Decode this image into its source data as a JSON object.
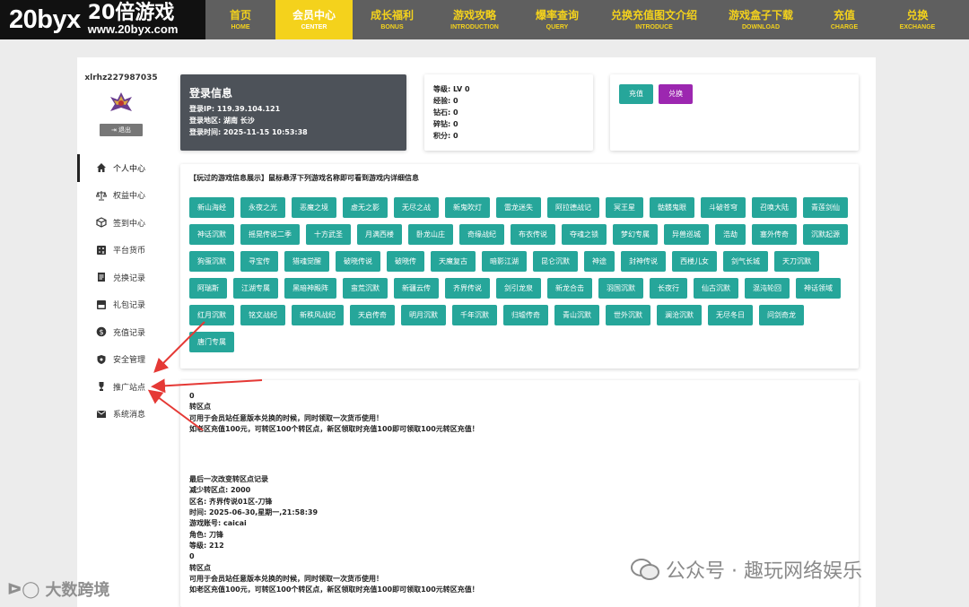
{
  "header": {
    "logo_big": "20byx",
    "logo_cn": "20倍游戏",
    "logo_url": "www.20byx.com",
    "nav": [
      {
        "cn": "首页",
        "en": "HOME",
        "w": 78
      },
      {
        "cn": "会员中心",
        "en": "CENTER",
        "w": 86,
        "active": true
      },
      {
        "cn": "成长福利",
        "en": "BONUS",
        "w": 88
      },
      {
        "cn": "游戏攻略",
        "en": "INTRODUCTION",
        "w": 96
      },
      {
        "cn": "爆率查询",
        "en": "QUERY",
        "w": 88
      },
      {
        "cn": "兑换充值图文介绍",
        "en": "INTRODUCE",
        "w": 128
      },
      {
        "cn": "游戏盒子下载",
        "en": "DOWNLOAD",
        "w": 110
      },
      {
        "cn": "充值",
        "en": "CHARGE",
        "w": 76
      },
      {
        "cn": "兑换",
        "en": "EXCHANGE",
        "w": 87
      }
    ]
  },
  "sidebar": {
    "username": "xlrhz227987035",
    "logout_label": "退出",
    "items": [
      {
        "label": "个人中心",
        "icon": "home-icon",
        "active": true
      },
      {
        "label": "权益中心",
        "icon": "scale-icon"
      },
      {
        "label": "签到中心",
        "icon": "cube-icon"
      },
      {
        "label": "平台货币",
        "icon": "calculator-icon"
      },
      {
        "label": "兑换记录",
        "icon": "document-icon"
      },
      {
        "label": "礼包记录",
        "icon": "gift-box-icon"
      },
      {
        "label": "充值记录",
        "icon": "dollar-icon"
      },
      {
        "label": "安全管理",
        "icon": "shield-icon"
      },
      {
        "label": "推广站点",
        "icon": "trophy-icon"
      },
      {
        "label": "系统消息",
        "icon": "mail-icon"
      }
    ]
  },
  "login": {
    "title": "登录信息",
    "ip": "登录IP:  119.39.104.121",
    "region": "登录地区:  湖南 长沙",
    "time": "登录时间:  2025-11-15 10:53:38"
  },
  "stats": {
    "level": "等级:  LV 0",
    "exp": "经验:  0",
    "diamond": "钻石:  0",
    "broken": "碎钻:  0",
    "points": "积分:  0"
  },
  "actions": {
    "recharge": "充值",
    "exchange": "兑换"
  },
  "games": {
    "hint": "【玩过的游戏信息展示】鼠标悬浮下列游戏名称即可看到游戏内详细信息",
    "items": [
      "新山海经",
      "永夜之光",
      "恶魔之境",
      "虚无之影",
      "无尽之战",
      "新鬼吹灯",
      "雷龙迷失",
      "阿拉德战记",
      "冥王星",
      "骷髅鬼眼",
      "斗破苍穹",
      "召唤大陆",
      "青莲剑仙",
      "神话沉默",
      "摇晃传说二季",
      "十方武圣",
      "月满西楼",
      "卧龙山庄",
      "奇缘战纪",
      "布衣传说",
      "夺魂之锁",
      "梦幻专属",
      "异兽巡城",
      "浩劫",
      "塞外传奇",
      "沉默起源",
      "狗蛋沉默",
      "寻宝传",
      "猎魂觉醒",
      "破晓传说",
      "破晓传",
      "天魔复古",
      "暗影江湖",
      "昆仑沉默",
      "神途",
      "封神传说",
      "西楼儿女",
      "剑气长城",
      "天刀沉默",
      "阿瑞斯",
      "江湖专属",
      "黑暗神殿阵",
      "蛮荒沉默",
      "新疆云传",
      "齐界传说",
      "剑引龙泉",
      "新龙合击",
      "羽国沉默",
      "长夜行",
      "仙古沉默",
      "混沌轮回",
      "神话领域",
      "红月沉默",
      "铭文战纪",
      "新秩风战纪",
      "天启传奇",
      "明月沉默",
      "千年沉默",
      "归墟传奇",
      "青山沉默",
      "世外沉默",
      "澜沧沉默",
      "无尽冬日",
      "问剑奇龙",
      "唐门专属"
    ]
  },
  "records": {
    "l1": "0",
    "l2": "转区点",
    "l3": "可用于会员站任意版本兑换的时候，同时领取一次货币使用！",
    "l4": "如老区充值100元，可转区100个转区点，新区领取时充值100即可领取100元转区充值！",
    "l5": "最后一次改变转区点记录",
    "l6": "减少转区点:  2000",
    "l7": "区名:  齐界传说01区-刀锋",
    "l8": "时间:  2025-06-30,星期一,21:58:39",
    "l9": "游戏账号:  caicai",
    "l10": "角色:  刀锋",
    "l11": "等级:  212",
    "l12": "0",
    "l13": "转区点",
    "l14": "可用于会员站任意版本兑换的时候，同时领取一次货币使用！",
    "l15": "如老区充值100元，可转区100个转区点，新区领取时充值100即可领取100元转区充值！"
  },
  "watermarks": {
    "wechat": "公众号 · 趣玩网络娱乐",
    "brand": "大数跨境"
  },
  "colors": {
    "accent": "#f4d21c",
    "teal": "#26a69a",
    "purple": "#9c27b0",
    "dark_card": "#4d5259",
    "arrow": "#e53935"
  }
}
